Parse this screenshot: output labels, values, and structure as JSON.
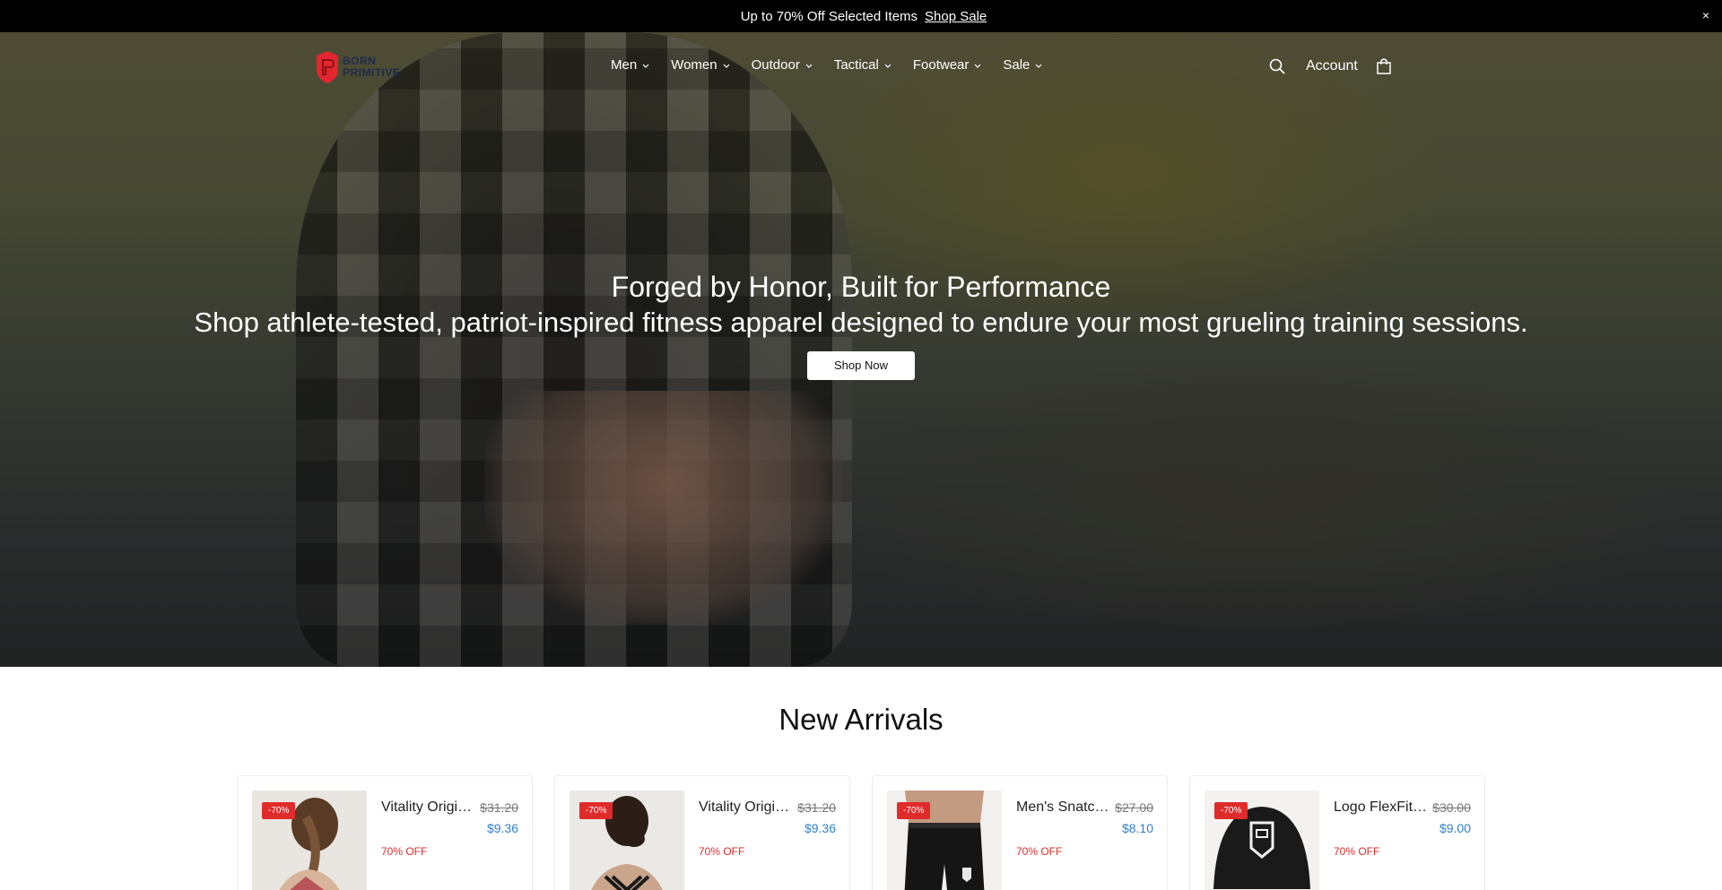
{
  "announcement": {
    "text": "Up to 70% Off Selected Items",
    "link": "Shop Sale",
    "close": "×",
    "gift_icon": ""
  },
  "brand": {
    "line1": "BORN",
    "line2": "PRIMITIVE",
    "color": "#e3262e"
  },
  "nav": {
    "items": [
      {
        "label": "Men"
      },
      {
        "label": "Women"
      },
      {
        "label": "Outdoor"
      },
      {
        "label": "Tactical"
      },
      {
        "label": "Footwear"
      },
      {
        "label": "Sale"
      }
    ],
    "account": "Account"
  },
  "hero": {
    "title": "Forged by Honor, Built for Performance",
    "subtitle": "Shop athlete-tested, patriot-inspired fitness apparel designed to endure your most grueling training sessions.",
    "button": "Shop Now"
  },
  "section": {
    "title": "New Arrivals"
  },
  "products": [
    {
      "badge": "-70%",
      "name": "Vitality Original Sports Bra",
      "old_price": "$31.20",
      "price": "$9.36",
      "discount": "70% OFF"
    },
    {
      "badge": "-70%",
      "name": "Vitality Original Sports Bra",
      "old_price": "$31.20",
      "price": "$9.36",
      "discount": "70% OFF"
    },
    {
      "badge": "-70%",
      "name": "Men's Snatch Shorts",
      "old_price": "$27.00",
      "price": "$8.10",
      "discount": "70% OFF"
    },
    {
      "badge": "-70%",
      "name": "Logo FlexFit Hat",
      "old_price": "$30.00",
      "price": "$9.00",
      "discount": "70% OFF"
    }
  ],
  "colors": {
    "accent_red": "#e02b2b",
    "price_blue": "#2f7fd1",
    "announcement_bg": "#000000"
  }
}
